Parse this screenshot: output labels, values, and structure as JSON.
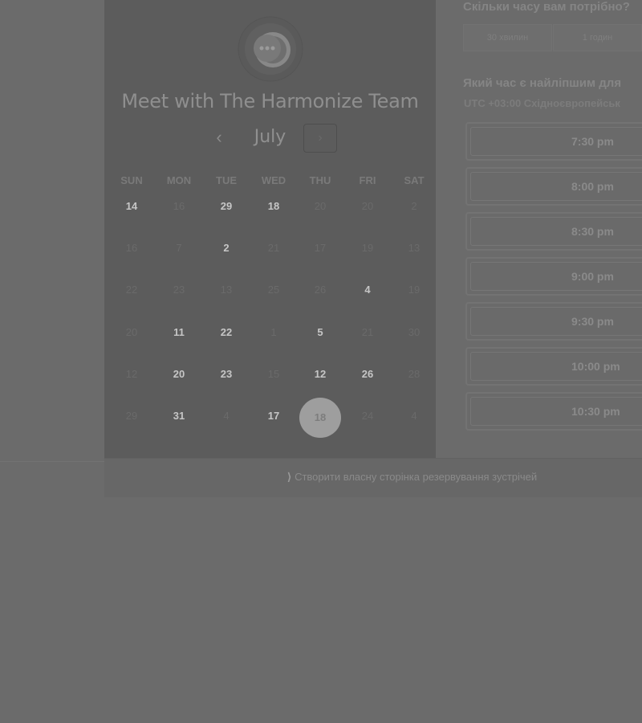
{
  "calendar": {
    "title": "Meet with The Harmonize Team",
    "month": "July",
    "prev_label": "‹",
    "next_label": "›",
    "weekdays": [
      "SUN",
      "MON",
      "TUE",
      "WED",
      "THU",
      "FRI",
      "SAT"
    ],
    "rows": [
      [
        "14",
        "16",
        "29",
        "18",
        "20",
        "20",
        "2"
      ],
      [
        "16",
        "7",
        "2",
        "21",
        "17",
        "19",
        "13"
      ],
      [
        "22",
        "23",
        "13",
        "25",
        "26",
        "4",
        "19"
      ],
      [
        "20",
        "11",
        "22",
        "1",
        "5",
        "21",
        "30"
      ],
      [
        "12",
        "20",
        "23",
        "15",
        "12",
        "26",
        "28"
      ],
      [
        "29",
        "31",
        "4",
        "17",
        "18",
        "24",
        "4"
      ]
    ],
    "active_days": [
      [
        0,
        0
      ],
      [
        0,
        2
      ],
      [
        0,
        3
      ],
      [
        1,
        2
      ],
      [
        2,
        5
      ],
      [
        3,
        1
      ],
      [
        3,
        2
      ],
      [
        3,
        4
      ],
      [
        4,
        1
      ],
      [
        4,
        2
      ],
      [
        4,
        4
      ],
      [
        4,
        5
      ],
      [
        5,
        1
      ],
      [
        5,
        3
      ]
    ],
    "selected_day": [
      5,
      4
    ]
  },
  "right": {
    "duration_heading": "Скільки часу вам потрібно?",
    "durations": [
      "30 хвилин",
      "1 годин"
    ],
    "time_heading": "Який час є найліпшим для",
    "timezone": "UTC +03:00 Східноєвропейськ",
    "slots": [
      "7:30 pm",
      "8:00 pm",
      "8:30 pm",
      "9:00 pm",
      "9:30 pm",
      "10:00 pm",
      "10:30 pm"
    ]
  },
  "footer": {
    "icon": "wand-icon",
    "link_label": "Створити власну сторінка резервування зустрічей"
  }
}
